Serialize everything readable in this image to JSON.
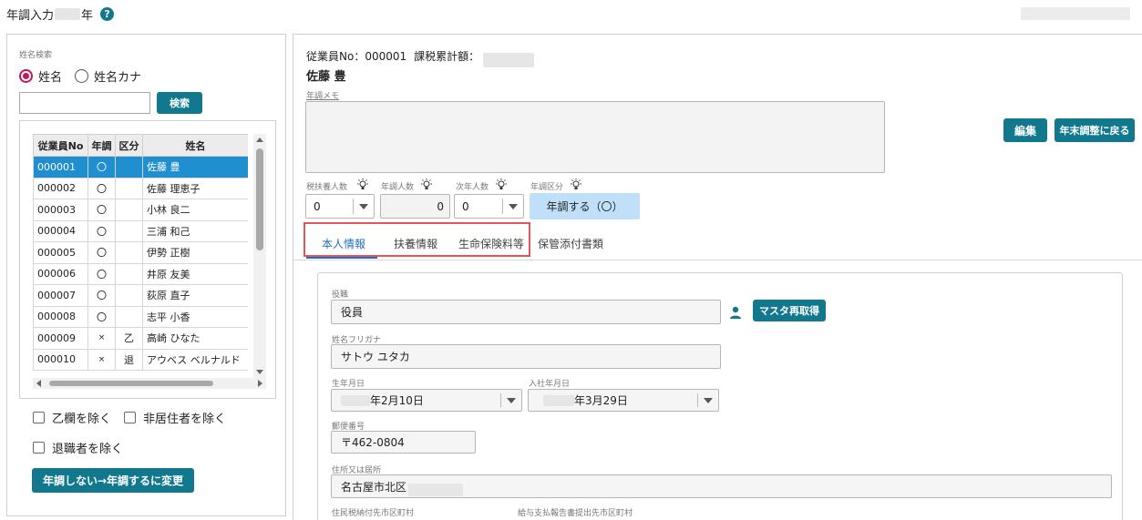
{
  "header": {
    "title_prefix": "年調入力",
    "title_suffix": "年",
    "help_icon": "help-circle-icon"
  },
  "search": {
    "section_label": "姓名検索",
    "radio_name": "姓名",
    "radio_kana": "姓名カナ",
    "selected": "姓名",
    "input_value": "",
    "search_button": "検索"
  },
  "table": {
    "headers": [
      "従業員No",
      "年調",
      "区分",
      "姓名"
    ],
    "rows": [
      {
        "no": "000001",
        "nencho": "〇",
        "kubun": "",
        "name": "佐藤 豊",
        "selected": true
      },
      {
        "no": "000002",
        "nencho": "〇",
        "kubun": "",
        "name": "佐藤 理恵子"
      },
      {
        "no": "000003",
        "nencho": "〇",
        "kubun": "",
        "name": "小林 良二"
      },
      {
        "no": "000004",
        "nencho": "〇",
        "kubun": "",
        "name": "三浦 和己"
      },
      {
        "no": "000005",
        "nencho": "〇",
        "kubun": "",
        "name": "伊勢 正樹"
      },
      {
        "no": "000006",
        "nencho": "〇",
        "kubun": "",
        "name": "井原 友美"
      },
      {
        "no": "000007",
        "nencho": "〇",
        "kubun": "",
        "name": "荻原 直子"
      },
      {
        "no": "000008",
        "nencho": "〇",
        "kubun": "",
        "name": "志平 小香"
      },
      {
        "no": "000009",
        "nencho": "×",
        "kubun": "乙",
        "name": "高崎 ひなた"
      },
      {
        "no": "000010",
        "nencho": "×",
        "kubun": "退",
        "name": "アウベス ベルナルド"
      }
    ]
  },
  "filters": {
    "exclude_otsu": "乙欄を除く",
    "exclude_nonresident": "非居住者を除く",
    "exclude_retired": "退職者を除く",
    "change_button": "年調しない→年調するに変更"
  },
  "detail": {
    "employee_no_label": "従業員No：000001",
    "taxable_total_label": "課税累計額：",
    "employee_name": "佐藤 豊",
    "memo_label": "年調メモ",
    "memo_value": "",
    "edit_button": "編集",
    "back_button": "年末調整に戻る",
    "count_fields": [
      {
        "label": "税扶養人数",
        "value": "0"
      },
      {
        "label": "年調人数",
        "value": "0"
      },
      {
        "label": "次年人数",
        "value": "0"
      },
      {
        "label": "年調区分",
        "value": "年調する（〇）"
      }
    ],
    "tabs": [
      "本人情報",
      "扶養情報",
      "生命保険料等",
      "保管添付書類"
    ],
    "active_tab": "本人情報"
  },
  "form": {
    "position_label": "役職",
    "position_value": "役員",
    "master_button": "マスタ再取得",
    "kana_label": "姓名フリガナ",
    "kana_value": "サトウ ユタカ",
    "birth_label": "生年月日",
    "birth_value": "年2月10日",
    "hire_label": "入社年月日",
    "hire_value": "年3月29日",
    "zip_label": "郵便番号",
    "zip_value": "〒462-0804",
    "address_label": "住所又は居所",
    "address_value": "名古屋市北区",
    "resident_tax_label": "住民税納付先市区町村",
    "salary_report_label": "給与支払報告書提出先市区町村"
  },
  "colors": {
    "accent": "#11788e",
    "selected_row": "#1f8fcf",
    "highlight_box": "#e2565a",
    "nencho_kubun_bg": "#bfe0f8",
    "active_tab": "#1f6fb8"
  }
}
